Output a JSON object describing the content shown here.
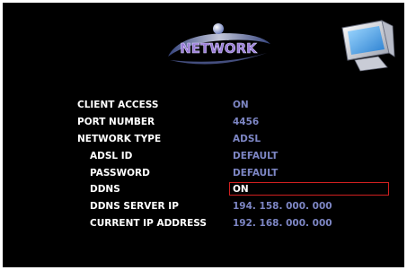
{
  "header": {
    "title": "NETWORK",
    "icon": "monitor-icon"
  },
  "colors": {
    "label": "#ffffff",
    "value": "#7d86c4",
    "selection": "#d02020"
  },
  "settings": [
    {
      "label": "CLIENT ACCESS",
      "value": "ON"
    },
    {
      "label": "PORT NUMBER",
      "value": "4456"
    },
    {
      "label": "NETWORK TYPE",
      "value": "ADSL"
    },
    {
      "label": "ADSL ID",
      "value": "DEFAULT"
    },
    {
      "label": "PASSWORD",
      "value": "DEFAULT"
    },
    {
      "label": "DDNS",
      "value": "ON",
      "selected": true
    },
    {
      "label": "DDNS SERVER IP",
      "value": "194. 158. 000. 000"
    },
    {
      "label": "CURRENT IP ADDRESS",
      "value": "192. 168. 000. 000"
    }
  ]
}
